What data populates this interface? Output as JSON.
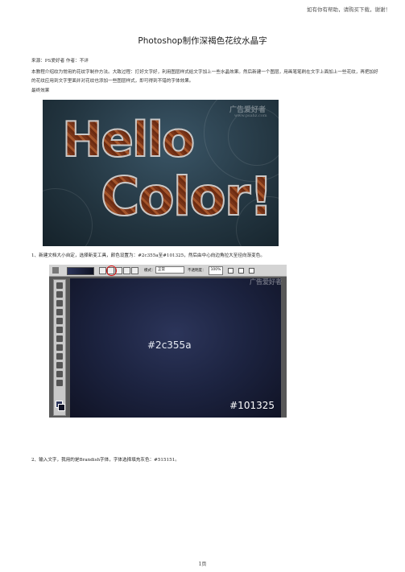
{
  "header_note": "如有你有帮助，请购买下载，谢谢！",
  "title": "Photoshop制作深褐色花纹水晶字",
  "source_line": "来源：PS爱好者  作者：不详",
  "intro": "本教程介绍纹为常用的花纹字制作方法。大致过程：打好文字好，利用图层样式给文字加上一些水晶效果。然后新建一个图层，用画笔笔刷在文字上面加上一些花纹，再把加好的花纹应用到文字里面并对花纹也添加一些图层样式，即可得到不错的字体效果。",
  "final_label": "最终效果",
  "figure1": {
    "line1": "Hello",
    "line2": "Color!",
    "watermark": "广告爱好者",
    "watermark_url": "www.psahz.com"
  },
  "step1": "1、新建文档大小自定，选择新变工具，颜色设置为：#2c355a至#101325，然后由中心向边角拉大至径向渐变色。",
  "figure2": {
    "mode_label": "模式：",
    "mode_value": "正常",
    "opacity_label": "不透明度：",
    "opacity_value": "100%",
    "color1": "#2c355a",
    "color2": "#101325",
    "watermark": "广告爱好者"
  },
  "step2": "2、输入文字，我用的是Brandish字体，字体选择填充灰色：#515151。",
  "page_number": "1页"
}
